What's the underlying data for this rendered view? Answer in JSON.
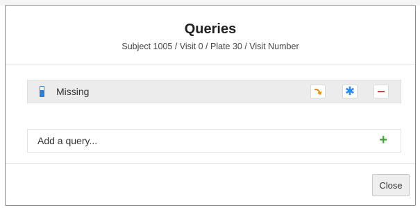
{
  "modal": {
    "title": "Queries",
    "subtitle": "Subject 1005 / Visit 0 / Plate 30 / Visit Number"
  },
  "queries": [
    {
      "label": "Missing",
      "status_icon": "battery-half-icon",
      "actions": [
        {
          "name": "reply",
          "icon": "reply-arrow-icon",
          "color": "#f08c00"
        },
        {
          "name": "star",
          "icon": "asterisk-icon",
          "glyph": "✱",
          "color": "#2a8cf0"
        },
        {
          "name": "remove",
          "icon": "minus-icon",
          "color": "#e53935"
        }
      ]
    }
  ],
  "add_query": {
    "placeholder": "Add a query...",
    "icon": "plus-icon",
    "icon_glyph": "+",
    "color": "#3aa33a"
  },
  "footer": {
    "close_label": "Close"
  }
}
